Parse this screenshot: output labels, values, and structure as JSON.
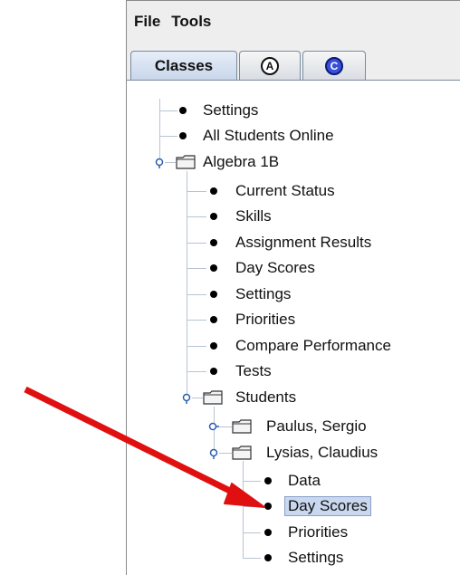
{
  "menu": {
    "file": "File",
    "tools": "Tools"
  },
  "tabs": {
    "classes": "Classes",
    "a": "A",
    "c": "C"
  },
  "tree": {
    "settings": "Settings",
    "all_students_online": "All Students Online",
    "algebra": "Algebra 1B",
    "algebra_children": {
      "current_status": "Current Status",
      "skills": "Skills",
      "assignment_results": "Assignment Results",
      "day_scores": "Day Scores",
      "settings": "Settings",
      "priorities": "Priorities",
      "compare_performance": "Compare Performance",
      "tests": "Tests",
      "students": "Students"
    },
    "students": {
      "paulus": "Paulus, Sergio",
      "lysias": "Lysias, Claudius"
    },
    "lysias_children": {
      "data": "Data",
      "day_scores": "Day Scores",
      "priorities": "Priorities",
      "settings": "Settings"
    }
  },
  "colors": {
    "arrow": "#e01010",
    "selection": "#c9d8ef",
    "tree_lines": "#b8c4d2"
  }
}
